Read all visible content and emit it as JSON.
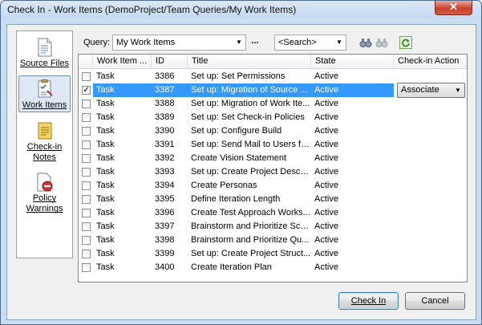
{
  "window": {
    "title": "Check In - Work Items (DemoProject/Team Queries/My Work Items)",
    "close_glyph": "✕"
  },
  "nav": {
    "items": [
      {
        "label": "Source Files",
        "icon": "source-files-icon",
        "selected": false
      },
      {
        "label": "Work Items",
        "icon": "work-items-icon",
        "selected": true
      },
      {
        "label": "Check-in Notes",
        "icon": "check-in-notes-icon",
        "selected": false
      },
      {
        "label": "Policy Warnings",
        "icon": "policy-warnings-icon",
        "selected": false
      }
    ]
  },
  "toolbar": {
    "query_label": "Query:",
    "query_value": "My Work Items",
    "ellipsis": "...",
    "search_value": "<Search>",
    "icons": [
      "binoculars-icon",
      "binoculars-disabled-icon",
      "refresh-icon"
    ]
  },
  "grid": {
    "columns": [
      "Work Item ...",
      "ID",
      "Title",
      "State",
      "Check-in Action"
    ],
    "rows": [
      {
        "checked": false,
        "type": "Task",
        "id": "3386",
        "title": "Set up: Set Permissions",
        "state": "Active",
        "action": ""
      },
      {
        "checked": true,
        "type": "Task",
        "id": "3387",
        "title": "Set up: Migration of Source ...",
        "state": "Active",
        "action": "Associate"
      },
      {
        "checked": false,
        "type": "Task",
        "id": "3388",
        "title": "Set up: Migration of Work Ite...",
        "state": "Active",
        "action": ""
      },
      {
        "checked": false,
        "type": "Task",
        "id": "3389",
        "title": "Set up: Set Check-in Policies",
        "state": "Active",
        "action": ""
      },
      {
        "checked": false,
        "type": "Task",
        "id": "3390",
        "title": "Set up: Configure Build",
        "state": "Active",
        "action": ""
      },
      {
        "checked": false,
        "type": "Task",
        "id": "3391",
        "title": "Set up: Send Mail to Users fo...",
        "state": "Active",
        "action": ""
      },
      {
        "checked": false,
        "type": "Task",
        "id": "3392",
        "title": "Create Vision Statement",
        "state": "Active",
        "action": ""
      },
      {
        "checked": false,
        "type": "Task",
        "id": "3393",
        "title": "Set up: Create Project Descri...",
        "state": "Active",
        "action": ""
      },
      {
        "checked": false,
        "type": "Task",
        "id": "3394",
        "title": "Create Personas",
        "state": "Active",
        "action": ""
      },
      {
        "checked": false,
        "type": "Task",
        "id": "3395",
        "title": "Define Iteration Length",
        "state": "Active",
        "action": ""
      },
      {
        "checked": false,
        "type": "Task",
        "id": "3396",
        "title": "Create Test Approach Works...",
        "state": "Active",
        "action": ""
      },
      {
        "checked": false,
        "type": "Task",
        "id": "3397",
        "title": "Brainstorm and Prioritize Sce...",
        "state": "Active",
        "action": ""
      },
      {
        "checked": false,
        "type": "Task",
        "id": "3398",
        "title": "Brainstorm and Prioritize Qu...",
        "state": "Active",
        "action": ""
      },
      {
        "checked": false,
        "type": "Task",
        "id": "3399",
        "title": "Set up: Create Project Struct...",
        "state": "Active",
        "action": ""
      },
      {
        "checked": false,
        "type": "Task",
        "id": "3400",
        "title": "Create Iteration Plan",
        "state": "Active",
        "action": ""
      }
    ]
  },
  "buttons": {
    "check_in": "Check In",
    "cancel": "Cancel"
  },
  "colors": {
    "selection": "#3399ff",
    "window_frame": "#c9ddf0"
  }
}
